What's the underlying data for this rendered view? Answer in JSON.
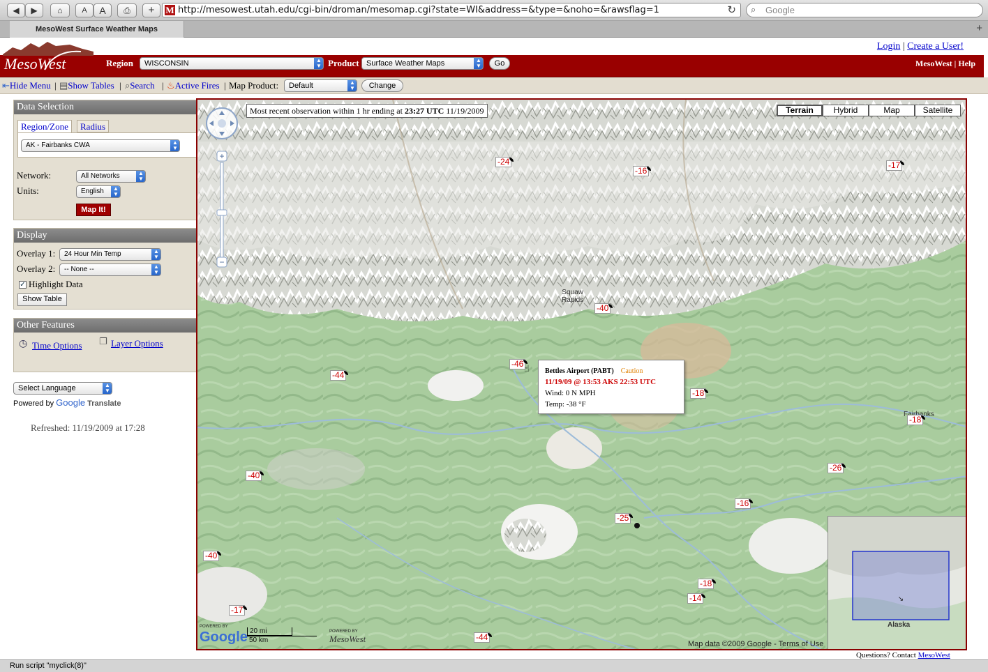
{
  "browser": {
    "url": "http://mesowest.utah.edu/cgi-bin/droman/mesomap.cgi?state=WI&address=&type=&noho=&rawsflag=1",
    "search_placeholder": "Google",
    "tab_title": "MesoWest Surface Weather Maps",
    "status_text": "Run script \"myclick(8)\"",
    "buttons": {
      "text_smaller": "A",
      "text_larger": "A",
      "new_tab": "+",
      "add": "+"
    }
  },
  "header": {
    "login": "Login",
    "separator": "|",
    "create_user": "Create a User!",
    "logo_text": "MesoWest",
    "region_label": "Region",
    "region_value": "WISCONSIN",
    "product_label": "Product",
    "product_value": "Surface Weather Maps",
    "go_label": "Go",
    "mesowest_link": "MesoWest",
    "help_link": "Help"
  },
  "menubar": {
    "hide_menu": "Hide Menu",
    "show_tables": "Show Tables",
    "search": "Search",
    "active_fires": "Active Fires",
    "map_product_label": "Map Product:",
    "map_product_value": "Default",
    "change_label": "Change"
  },
  "data_selection": {
    "title": "Data Selection",
    "tab_region": "Region/Zone",
    "tab_radius": "Radius",
    "zone_value": "AK - Fairbanks CWA",
    "network_label": "Network:",
    "network_value": "All Networks",
    "units_label": "Units:",
    "units_value": "English",
    "map_it": "Map It!"
  },
  "display": {
    "title": "Display",
    "overlay1_label": "Overlay 1:",
    "overlay1_value": "24 Hour Min Temp",
    "overlay2_label": "Overlay 2:",
    "overlay2_value": "-- None --",
    "highlight_label": "Highlight Data",
    "highlight_checked": true,
    "show_table": "Show Table"
  },
  "other_features": {
    "title": "Other Features",
    "time_options": "Time Options",
    "layer_options": "Layer Options"
  },
  "translate": {
    "select_language": "Select Language",
    "powered_by": "Powered by",
    "google": "Google",
    "translate": "Translate"
  },
  "refreshed": "Refreshed: 11/19/2009 at 17:28",
  "map": {
    "obs_prefix": "Most recent observation within 1 hr ending at",
    "obs_time": "23:27 UTC",
    "obs_date": "11/19/2009",
    "map_types": [
      "Terrain",
      "Hybrid",
      "Map",
      "Satellite"
    ],
    "active_map_type": "Terrain",
    "place_squaw": "Squaw",
    "place_rapids": "Rapids",
    "place_fairbanks": "Fairbanks",
    "markers": [
      "-24",
      "-16",
      "-17",
      "-40",
      "-46",
      "-44",
      "-18",
      "-18",
      "-26",
      "-40",
      "-16",
      "-25",
      "-40",
      "-18",
      "-14",
      "-17",
      "-44"
    ],
    "popup": {
      "station": "Bettles Airport (PABT)",
      "status": "Caution",
      "time": "11/19/09 @ 13:53 AKS  22:53 UTC",
      "wind": "Wind:  0 N MPH",
      "temp": "Temp: -38 °F"
    },
    "minimap_label": "Alaska",
    "copyright": "Map data ©2009 Google - Terms of Use",
    "scale_mi": "20 mi",
    "scale_km": "50 km",
    "powered_google": "POWERED BY",
    "google_logo": "Google",
    "powered_mesowest": "POWERED BY",
    "mesowest_logo": "MesoWest",
    "colors": {
      "marker_text": "#cc0000",
      "border": "#8a0000",
      "caution": "#e08000",
      "time": "#cc0000"
    }
  },
  "footer": {
    "questions": "Questions? Contact",
    "contact_link": "MesoWest"
  }
}
